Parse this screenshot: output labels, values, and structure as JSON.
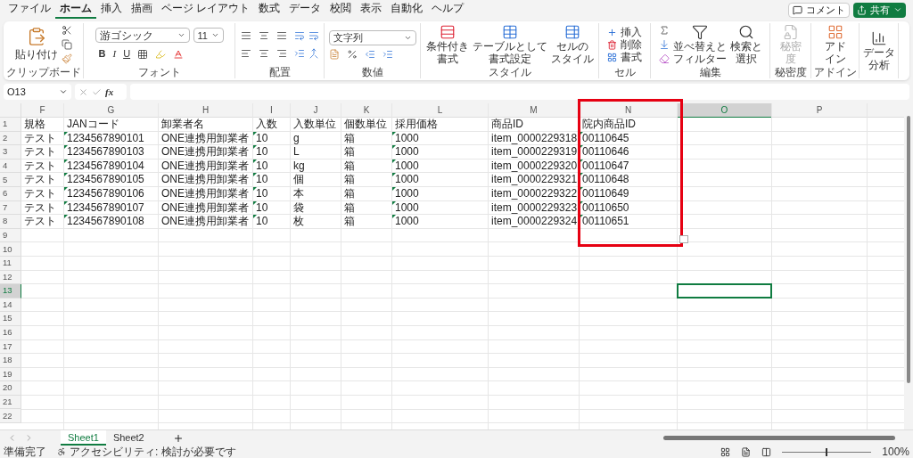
{
  "menu_tabs": [
    {
      "label": "ファイル",
      "selected": false
    },
    {
      "label": "ホーム",
      "selected": true
    },
    {
      "label": "挿入",
      "selected": false
    },
    {
      "label": "描画",
      "selected": false
    },
    {
      "label": "ページ レイアウト",
      "selected": false
    },
    {
      "label": "数式",
      "selected": false
    },
    {
      "label": "データ",
      "selected": false
    },
    {
      "label": "校閲",
      "selected": false
    },
    {
      "label": "表示",
      "selected": false
    },
    {
      "label": "自動化",
      "selected": false
    },
    {
      "label": "ヘルプ",
      "selected": false
    }
  ],
  "comment_button": "コメント",
  "share_button": "共有",
  "ribbon": {
    "clipboard": {
      "label": "クリップボード",
      "paste": "貼り付け"
    },
    "font": {
      "label": "フォント",
      "font_name": "游ゴシック",
      "font_size": "11",
      "bold": "B",
      "italic": "I",
      "underline": "U"
    },
    "alignment": {
      "label": "配置"
    },
    "number": {
      "label": "数値",
      "format": "文字列"
    },
    "styles": {
      "label": "スタイル",
      "items": [
        [
          "条件付き",
          "書式"
        ],
        [
          "テーブルとして",
          "書式設定"
        ],
        [
          "セルの",
          "スタイル"
        ]
      ]
    },
    "cells": {
      "label": "セル",
      "items": [
        "挿入",
        "削除",
        "書式"
      ]
    },
    "editing": {
      "label": "編集",
      "sort": [
        "並べ替えと",
        "フィルター"
      ],
      "find": [
        "検索と",
        "選択"
      ]
    },
    "sensitivity": {
      "label": "秘密度",
      "button": [
        "秘密",
        "度"
      ],
      "disabled": true
    },
    "addins": {
      "label": "アドイン",
      "button": [
        "アド",
        "イン"
      ]
    },
    "analysis": {
      "button": [
        "データ",
        "分析"
      ]
    }
  },
  "name_box": "O13",
  "function_label": "fx",
  "columns": [
    {
      "label": "F",
      "flagged": false,
      "selected": false
    },
    {
      "label": "G",
      "flagged": true,
      "selected": false
    },
    {
      "label": "H",
      "flagged": false,
      "selected": false
    },
    {
      "label": "I",
      "flagged": true,
      "selected": false
    },
    {
      "label": "J",
      "flagged": false,
      "selected": false
    },
    {
      "label": "K",
      "flagged": false,
      "selected": false
    },
    {
      "label": "L",
      "flagged": true,
      "selected": false
    },
    {
      "label": "M",
      "flagged": false,
      "selected": false
    },
    {
      "label": "N",
      "flagged": true,
      "selected": false
    },
    {
      "label": "O",
      "selected": true
    },
    {
      "label": "P",
      "selected": false
    }
  ],
  "rows": [
    {
      "number": "1",
      "selected": false,
      "cells": [
        "規格",
        "JANコード",
        "卸業者名",
        "入数",
        "入数単位",
        "個数単位",
        "採用価格",
        "商品ID",
        "院内商品ID"
      ]
    },
    {
      "number": "2",
      "selected": false,
      "cells": [
        "テスト",
        "1234567890101",
        "ONE連携用卸業者",
        "10",
        "g",
        "箱",
        "1000",
        "item_0000229318",
        "00110645"
      ]
    },
    {
      "number": "3",
      "selected": false,
      "cells": [
        "テスト",
        "1234567890103",
        "ONE連携用卸業者",
        "10",
        "L",
        "箱",
        "1000",
        "item_0000229319",
        "00110646"
      ]
    },
    {
      "number": "4",
      "selected": false,
      "cells": [
        "テスト",
        "1234567890104",
        "ONE連携用卸業者",
        "10",
        "kg",
        "箱",
        "1000",
        "item_0000229320",
        "00110647"
      ]
    },
    {
      "number": "5",
      "selected": false,
      "cells": [
        "テスト",
        "1234567890105",
        "ONE連携用卸業者",
        "10",
        "個",
        "箱",
        "1000",
        "item_0000229321",
        "00110648"
      ]
    },
    {
      "number": "6",
      "selected": false,
      "cells": [
        "テスト",
        "1234567890106",
        "ONE連携用卸業者",
        "10",
        "本",
        "箱",
        "1000",
        "item_0000229322",
        "00110649"
      ]
    },
    {
      "number": "7",
      "selected": false,
      "cells": [
        "テスト",
        "1234567890107",
        "ONE連携用卸業者",
        "10",
        "袋",
        "箱",
        "1000",
        "item_0000229323",
        "00110650"
      ]
    },
    {
      "number": "8",
      "selected": false,
      "cells": [
        "テスト",
        "1234567890108",
        "ONE連携用卸業者",
        "10",
        "枚",
        "箱",
        "1000",
        "item_0000229324",
        "00110651"
      ]
    },
    {
      "number": "9",
      "selected": false
    },
    {
      "number": "10",
      "selected": false
    },
    {
      "number": "11",
      "selected": false
    },
    {
      "number": "12",
      "selected": false
    },
    {
      "number": "13",
      "selected": true
    },
    {
      "number": "14",
      "selected": false
    },
    {
      "number": "15",
      "selected": false
    },
    {
      "number": "16",
      "selected": false
    },
    {
      "number": "17",
      "selected": false
    },
    {
      "number": "18",
      "selected": false
    },
    {
      "number": "19",
      "selected": false
    },
    {
      "number": "20",
      "selected": false
    },
    {
      "number": "21",
      "selected": false
    },
    {
      "number": "22",
      "selected": false
    }
  ],
  "sheet_tabs": [
    {
      "label": "Sheet1",
      "selected": true
    },
    {
      "label": "Sheet2",
      "selected": false
    }
  ],
  "status": {
    "ready": "準備完了",
    "accessibility": "アクセシビリティ: 検討が必要です",
    "zoom_slider": {
      "level": 0.5
    },
    "zoom": "100%"
  }
}
